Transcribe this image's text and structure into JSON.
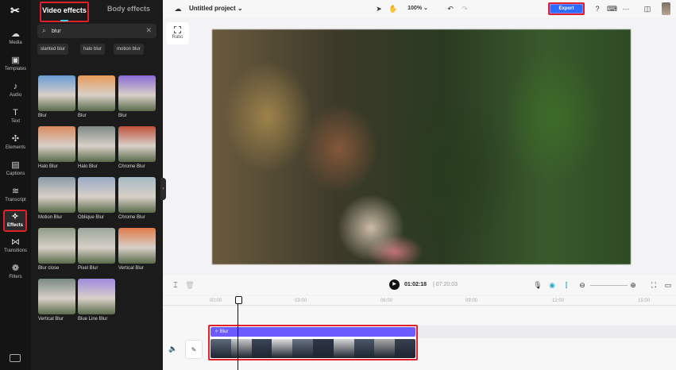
{
  "rail": {
    "logo": "✂",
    "items": [
      {
        "label": "Media",
        "icon": "☁"
      },
      {
        "label": "Templates",
        "icon": "▣"
      },
      {
        "label": "Audio",
        "icon": "♪"
      },
      {
        "label": "Text",
        "icon": "T"
      },
      {
        "label": "Elements",
        "icon": "✣"
      },
      {
        "label": "Captions",
        "icon": "▤"
      },
      {
        "label": "Transcript",
        "icon": "≋"
      },
      {
        "label": "Effects",
        "icon": "✧"
      },
      {
        "label": "Transitions",
        "icon": "⋈"
      },
      {
        "label": "Filters",
        "icon": "❁"
      }
    ],
    "active": "Effects"
  },
  "panel": {
    "tabs": {
      "video": "Video effects",
      "body": "Body effects"
    },
    "search": {
      "value": "blur",
      "placeholder": ""
    },
    "chips": [
      "slanted blur",
      "halo blur",
      "motion blur"
    ],
    "effects": [
      "Blur",
      "Blur",
      "Blur",
      "Halo Blur",
      "Halo Blur",
      "Chrome Blur",
      "Motion Blur",
      "Oblique Blur",
      "Chrome Blur",
      "Blur close",
      "Pixel Blur",
      "Vertical Blur",
      "Vertical Blur",
      "Blue Line Blur"
    ],
    "thumb_colors": [
      "#6a9ad6",
      "#e89b5a",
      "#8a6ad6",
      "#d98a60",
      "#7e8a86",
      "#c0503a",
      "#8a9aa6",
      "#9aaac6",
      "#a6bac2",
      "#8e9a86",
      "#9aa69a",
      "#e07a4a",
      "#7a8a82",
      "#a08ae0"
    ]
  },
  "topbar": {
    "project_title": "Untitled project",
    "zoom": "100%",
    "export_label": "Export"
  },
  "preview": {
    "ratio_label": "Ratio"
  },
  "timeline": {
    "current_time": "01:02:18",
    "total_time": "07:20:03",
    "ticks": [
      "00:00",
      "03:00",
      "06:00",
      "09:00",
      "12:00",
      "15:00"
    ],
    "effect_clip_label": "Blur",
    "frame_colors": [
      "#5e6a7a",
      "#c9c9c9",
      "#3b4658",
      "#e0e0e0",
      "#6a7484",
      "#2f3646",
      "#d6d6d6",
      "#4c586a",
      "#a8a8a8",
      "#394050"
    ]
  }
}
